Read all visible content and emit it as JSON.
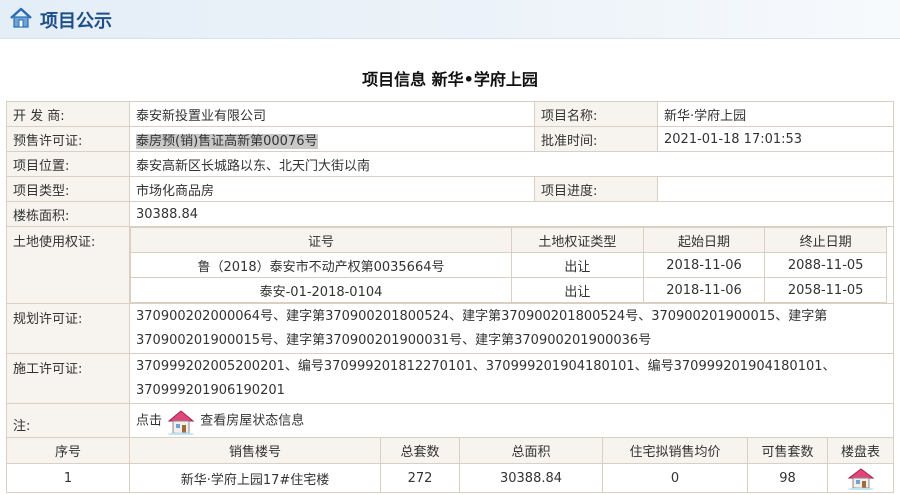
{
  "header": {
    "title": "项目公示"
  },
  "page_title": "项目信息 新华•学府上园",
  "info": {
    "developer_label": "开 发 商:",
    "developer_value": "泰安新投置业有限公司",
    "project_name_label": "项目名称:",
    "project_name_value": "新华·学府上园",
    "presale_label": "预售许可证:",
    "presale_value": "泰房预(销)售证高新第00076号",
    "approval_time_label": "批准时间:",
    "approval_time_value": "2021-01-18 17:01:53",
    "location_label": "项目位置:",
    "location_value": "泰安高新区长城路以东、北天门大街以南",
    "type_label": "项目类型:",
    "type_value": "市场化商品房",
    "progress_label": "项目进度:",
    "progress_value": "",
    "floor_area_label": "楼栋面积:",
    "floor_area_value": "30388.84",
    "land_label": "土地使用权证:",
    "planning_label": "规划许可证:",
    "planning_value": "370900202000064号、建字第370900201800524、建字第370900201800524号、370900201900015、建字第370900201900015号、建字第370900201900031号、建字第370900201900036号",
    "construction_label": "施工许可证:",
    "construction_value": "370999202005200201、编号370999201812270101、370999201904180101、编号370999201904180101、370999201906190201",
    "note_label": "注:",
    "note_click": "点击",
    "note_link": "查看房屋状态信息"
  },
  "land": {
    "headers": [
      "证号",
      "土地权证类型",
      "起始日期",
      "终止日期"
    ],
    "rows": [
      [
        "鲁（2018）泰安市不动产权第0035664号",
        "出让",
        "2018-11-06",
        "2088-11-05"
      ],
      [
        "泰安-01-2018-0104",
        "出让",
        "2018-11-06",
        "2058-11-05"
      ]
    ]
  },
  "sales": {
    "headers": [
      "序号",
      "销售楼号",
      "总套数",
      "总面积",
      "住宅拟销售均价",
      "可售套数",
      "楼盘表"
    ],
    "rows": [
      [
        "1",
        "新华·学府上园17#住宅楼",
        "272",
        "30388.84",
        "0",
        "98"
      ]
    ]
  },
  "icons": {
    "header": "home-icon",
    "house": "house-icon"
  },
  "colors": {
    "header_title": "#1d4f86",
    "label_bg": "#f7f3ee",
    "border": "#d9cfc3",
    "highlight": "#c9c9c9"
  }
}
